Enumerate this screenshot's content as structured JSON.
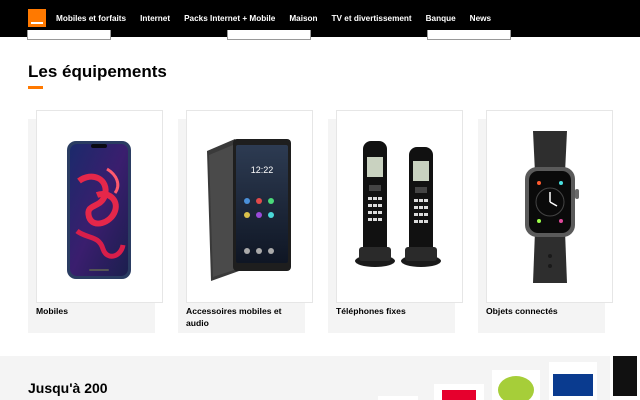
{
  "nav": {
    "items": [
      {
        "label": "Mobiles et forfaits"
      },
      {
        "label": "Internet"
      },
      {
        "label": "Packs Internet + Mobile"
      },
      {
        "label": "Maison"
      },
      {
        "label": "TV et divertissement"
      },
      {
        "label": "Banque"
      },
      {
        "label": "News"
      }
    ]
  },
  "section": {
    "title": "Les équipements"
  },
  "cards": [
    {
      "label": "Mobiles",
      "icon": "smartphone-icon"
    },
    {
      "label": "Accessoires mobiles et audio",
      "icon": "phone-case-icon"
    },
    {
      "label": "Téléphones fixes",
      "icon": "cordless-phone-icon"
    },
    {
      "label": "Objets connectés",
      "icon": "smartwatch-icon"
    }
  ],
  "band": {
    "title": "Jusqu'à 200",
    "channel_logos": [
      "tf1-logo",
      "gulli-logo",
      "mtv-logo"
    ]
  },
  "colors": {
    "brand": "#ff7900",
    "nav_bg": "#000000",
    "band_bg": "#f4f4f4"
  }
}
